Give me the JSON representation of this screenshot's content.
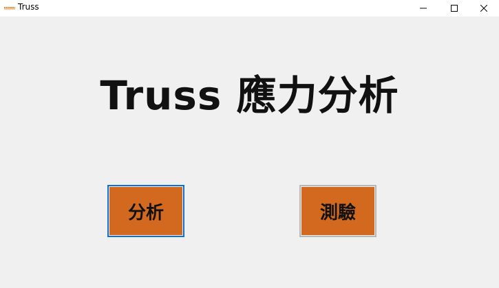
{
  "window": {
    "title": "Truss",
    "controls": {
      "minimize_icon": "minimize-icon",
      "maximize_icon": "maximize-icon",
      "close_icon": "close-icon"
    }
  },
  "main": {
    "headline": "Truss 應力分析",
    "buttons": {
      "analysis": "分析",
      "test": "測驗"
    }
  },
  "colors": {
    "button_fill": "#d2691e",
    "focus_border": "#0a6fd6",
    "background": "#f0f0f0"
  }
}
